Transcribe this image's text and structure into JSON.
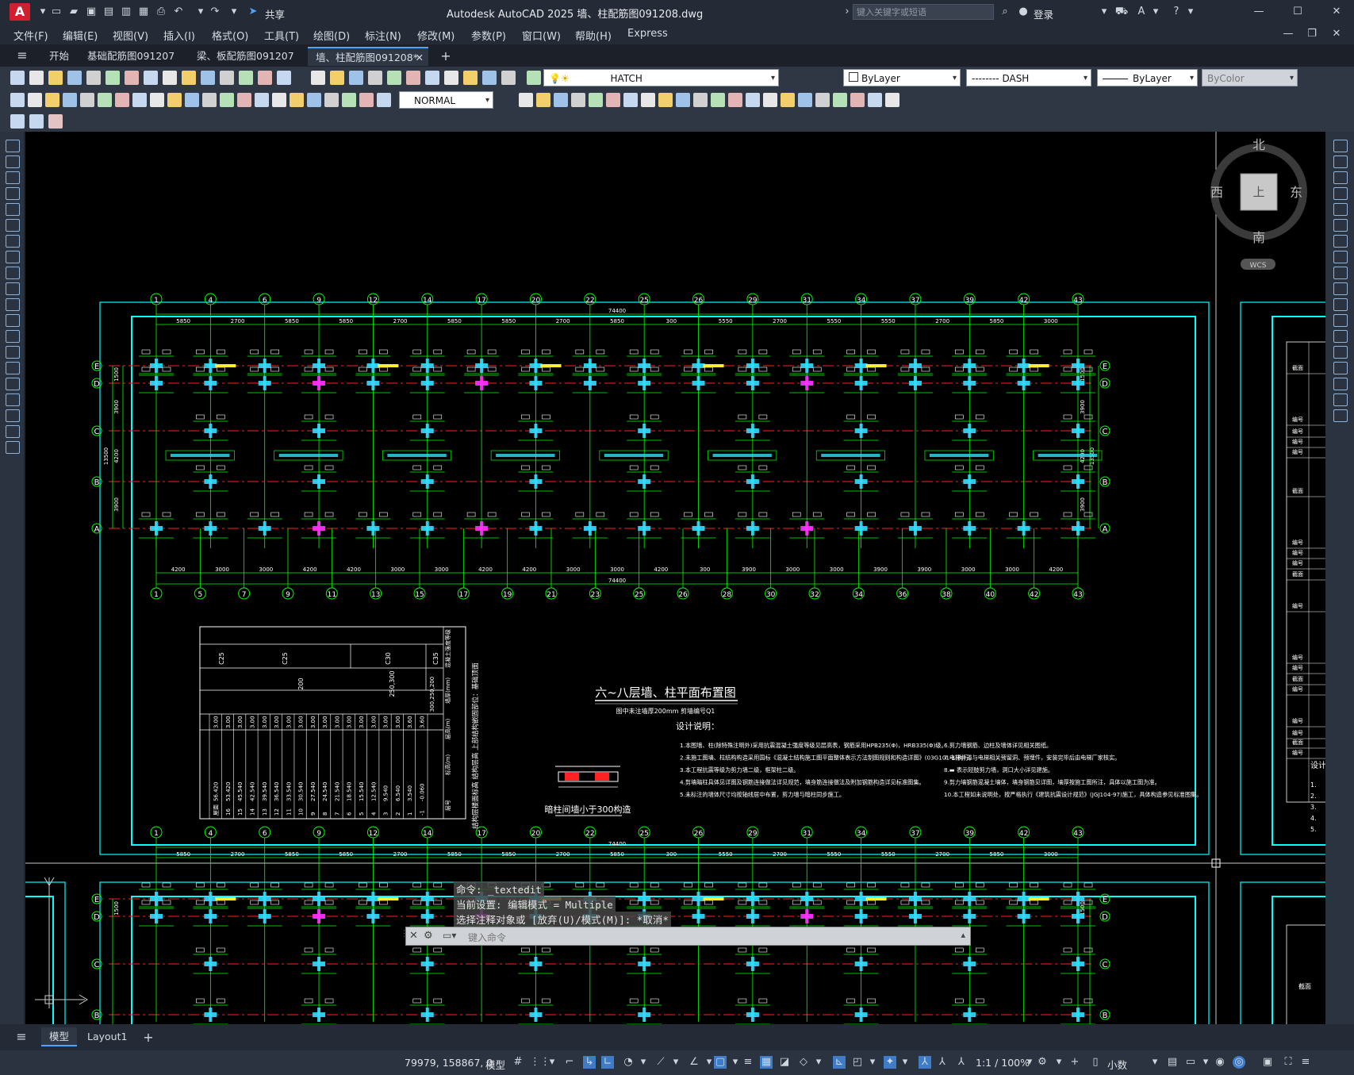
{
  "title_bar": {
    "app_logo": "A",
    "share_label": "共享",
    "title": "Autodesk AutoCAD 2025    墙、柱配筋图091208.dwg",
    "search_placeholder": "键入关键字或短语",
    "login_label": "登录"
  },
  "menu": [
    "文件(F)",
    "编辑(E)",
    "视图(V)",
    "插入(I)",
    "格式(O)",
    "工具(T)",
    "绘图(D)",
    "标注(N)",
    "修改(M)",
    "参数(P)",
    "窗口(W)",
    "帮助(H)",
    "Express"
  ],
  "tabs": [
    {
      "label": "开始",
      "active": false
    },
    {
      "label": "基础配筋图091207",
      "active": false
    },
    {
      "label": "梁、板配筋图091207",
      "active": false
    },
    {
      "label": "墙、柱配筋图091208*",
      "active": true
    }
  ],
  "toolbar": {
    "layer_value": "HATCH",
    "color_value": "ByLayer",
    "linetype_value": "-------- DASH",
    "lineweight_value": "ByLayer",
    "plotstyle_value": "ByColor",
    "textstyle_value": "NORMAL"
  },
  "viewcube": {
    "north": "北",
    "south": "南",
    "east": "东",
    "west": "西",
    "center": "上",
    "ucs": "WCS"
  },
  "drawing": {
    "title": "六~八层墙、柱平面布置图",
    "subtitle": "图中未注墙厚200mm 剪墙编号Q1",
    "notes_title": "设计说明：",
    "detail_caption": "暗柱间墙小于300构造",
    "top_axes": [
      "1",
      "4",
      "6",
      "9",
      "12",
      "14",
      "17",
      "20",
      "22",
      "25",
      "26",
      "29",
      "31",
      "34",
      "37",
      "39",
      "42",
      "43"
    ],
    "bottom_axes": [
      "1",
      "5",
      "7",
      "9",
      "11",
      "13",
      "15",
      "17",
      "19",
      "21",
      "23",
      "25",
      "26",
      "28",
      "30",
      "32",
      "34",
      "36",
      "38",
      "40",
      "42",
      "43"
    ],
    "row_axes": [
      "E",
      "D",
      "C",
      "B",
      "A"
    ],
    "total_dim": "74400",
    "top_dims": [
      "5850",
      "2700",
      "5850",
      "5850",
      "2700",
      "5850",
      "5850",
      "2700",
      "5850",
      "300",
      "5550",
      "2700",
      "5550",
      "5550",
      "2700",
      "5850",
      "3000"
    ],
    "bottom_dims": [
      "4200",
      "3000",
      "3000",
      "4200",
      "4200",
      "3000",
      "3000",
      "4200",
      "4200",
      "3000",
      "3000",
      "4200",
      "300",
      "3900",
      "3000",
      "3000",
      "3900",
      "3900",
      "3000",
      "3000",
      "4200",
      "3000"
    ],
    "right_total": "13500",
    "side_dims": [
      "1500",
      "3900",
      "4200",
      "3900"
    ],
    "notes_left": [
      "1.本图墙、柱(除特殊注明外)采用抗震混凝土强度等级见层高表，钢筋采用HPB235(Φ)，HRB335(Φ)级。",
      "2.未施工图墙、柱结构构造采用国标《混凝土结构施工图平面整体表示方法制图规则和构造详图》(03G101-1)执行。",
      "3.本工程抗震等级为剪力墙二级，框架柱二级。",
      "4.剪墙暗柱具体见详图及钢筋连接做法详见规范，墙身筋连接做法及附加钢筋构造详见标准图集。",
      "5.未标注的墙体尺寸均按轴线居中布置，剪力墙与暗柱同步施工。"
    ],
    "notes_right": [
      "6.剪力墙钢筋、边柱及墙体详见相关图纸。",
      "7.电梯井道与电梯相关预留洞、预埋件，安装完毕后由电梯厂家核实。",
      "8.▬ 表示短肢剪力墙，洞口大小详见建施。",
      "9.剪力墙钢筋混凝土墙体，墙身钢筋见详图，墙厚按施工图所注，具体以施工图为准。",
      "10.本工程如未说明处，按严格执行《建筑抗震设计规范》(JGJ104-97)施工，具体构造参见标准图集。"
    ],
    "level_table": {
      "header_concrete": [
        "C25",
        "C25",
        "C30",
        "C35"
      ],
      "header_wall": [
        "200",
        "250,300",
        "300,250,200"
      ],
      "floors": [
        "屋面",
        "16",
        "15",
        "14",
        "13",
        "12",
        "11",
        "10",
        "9",
        "8",
        "7",
        "6",
        "5",
        "4",
        "3",
        "2",
        "1",
        "-1"
      ],
      "elevations": [
        "56.420",
        "53.420",
        "45.540",
        "42.540",
        "39.540",
        "36.540",
        "33.540",
        "30.540",
        "27.540",
        "24.540",
        "21.540",
        "18.540",
        "15.540",
        "12.540",
        "9.540",
        "6.540",
        "3.540",
        "-0.060"
      ],
      "heights": [
        "3.00",
        "3.00",
        "3.00",
        "3.00",
        "3.00",
        "3.00",
        "3.00",
        "3.00",
        "3.00",
        "3.00",
        "3.00",
        "3.00",
        "3.00",
        "3.00",
        "3.00",
        "3.00",
        "3.60",
        "3.60"
      ],
      "side_note": "结构层楼面标高 结构层高 上部结构嵌固部位：基础顶面",
      "row_labels": [
        "层号",
        "标高(m)",
        "层高(m)",
        "墙厚(mm)",
        "混凝土强度等级"
      ]
    }
  },
  "side_frame_labels": [
    "截面",
    "编号",
    "编号",
    "编号",
    "编号",
    "截面",
    "编号",
    "编号",
    "编号",
    "截面",
    "编号",
    "编号",
    "编号",
    "截面",
    "编号",
    "编号",
    "编号",
    "截面",
    "编号"
  ],
  "side_frame_notes": [
    "设计",
    "1.",
    "2.",
    "3.",
    "4.",
    "5."
  ],
  "command": {
    "history": [
      "命令: _textedit",
      "当前设置: 编辑模式 = Multiple",
      "选择注释对象或 [放弃(U)/模式(M)]: *取消*"
    ],
    "placeholder": "键入命令"
  },
  "layout_tabs": [
    {
      "label": "模型",
      "active": true
    },
    {
      "label": "Layout1",
      "active": false
    }
  ],
  "status": {
    "coords": "79979, 158867, 0",
    "model": "模型",
    "scale": "1:1 / 100%",
    "units": "小数"
  },
  "colors": {
    "accent": "#4da3ff",
    "frame": "#00ffff",
    "axis": "#00ff00",
    "centerline": "#ff0000",
    "wall": "#ff00ff",
    "dim": "#00ff00",
    "text_white": "#ffffff"
  }
}
